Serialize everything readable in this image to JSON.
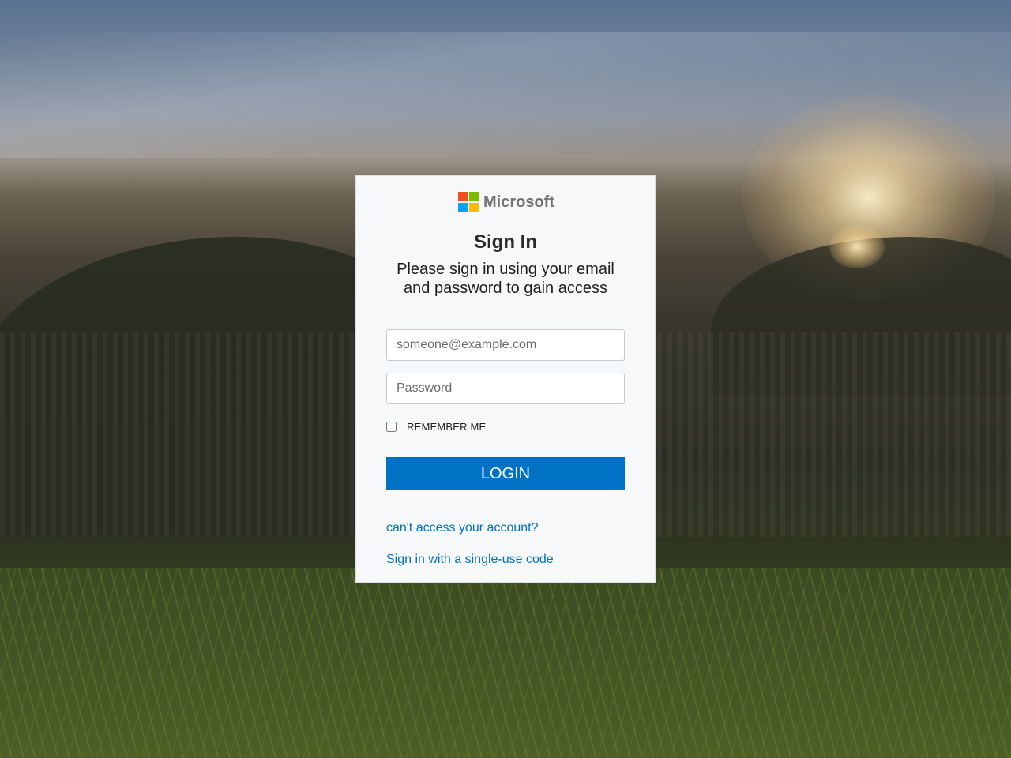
{
  "brand": {
    "name": "Microsoft",
    "logo_colors": [
      "#f25022",
      "#7fba00",
      "#00a4ef",
      "#ffb900"
    ]
  },
  "form": {
    "title": "Sign In",
    "subtitle": "Please sign in using your email and password to gain access",
    "email_placeholder": "someone@example.com",
    "email_value": "",
    "password_placeholder": "Password",
    "password_value": "",
    "remember_label": "REMEMBER ME",
    "remember_checked": false,
    "login_label": "LOGIN",
    "links": {
      "cant_access": "can't access your account?",
      "single_use": "Sign in with a single-use code"
    }
  },
  "colors": {
    "accent": "#0072c6",
    "card_bg": "#f7f8fa"
  }
}
